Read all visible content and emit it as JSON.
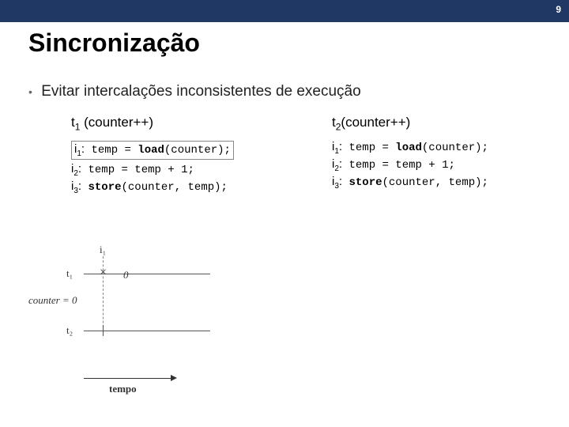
{
  "page_number": "9",
  "title": "Sincronização",
  "bullet": "Evitar intercalações inconsistentes de execução",
  "threads": {
    "left": {
      "label_prefix": "t",
      "label_sub": "1",
      "label_suffix": " (counter++)",
      "lines": [
        {
          "i_sub": "1",
          "code_before": "temp = ",
          "kw": "load",
          "code_after": "(counter);",
          "highlighted": true
        },
        {
          "i_sub": "2",
          "code_before": "temp = temp + 1;",
          "kw": "",
          "code_after": "",
          "highlighted": false
        },
        {
          "i_sub": "3",
          "code_before": "",
          "kw": "store",
          "code_after": "(counter, temp);",
          "highlighted": false
        }
      ]
    },
    "right": {
      "label_prefix": "t",
      "label_sub": "2",
      "label_suffix": "(counter++)",
      "lines": [
        {
          "i_sub": "1",
          "code_before": "temp = ",
          "kw": "load",
          "code_after": "(counter);",
          "highlighted": false
        },
        {
          "i_sub": "2",
          "code_before": "temp = temp + 1;",
          "kw": "",
          "code_after": "",
          "highlighted": false
        },
        {
          "i_sub": "3",
          "code_before": "",
          "kw": "store",
          "code_after": "(counter, temp);",
          "highlighted": false
        }
      ]
    }
  },
  "diagram": {
    "t1_label": "t₁",
    "t2_label": "t₂",
    "counter_label": "counter = 0",
    "i1_label": "i₁",
    "zero_label": "0",
    "tempo_label": "tempo"
  }
}
